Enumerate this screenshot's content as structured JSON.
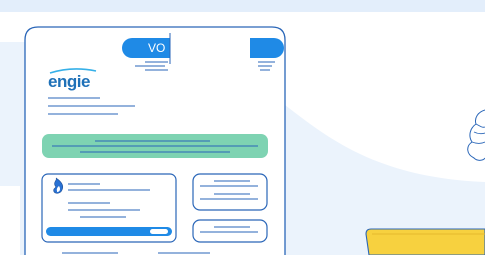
{
  "illustration": {
    "brand_logo_text": "engie",
    "tab_label": "VO",
    "colors": {
      "accent_blue": "#1f8ae6",
      "outline_blue": "#2a66b8",
      "background_tint": "#ebf3fc",
      "green_bar": "#7ed3b2",
      "yellow_card": "#f7d13f",
      "flame_blue": "#2a72d4"
    },
    "icons": [
      "flame-icon",
      "hand-icon"
    ]
  }
}
